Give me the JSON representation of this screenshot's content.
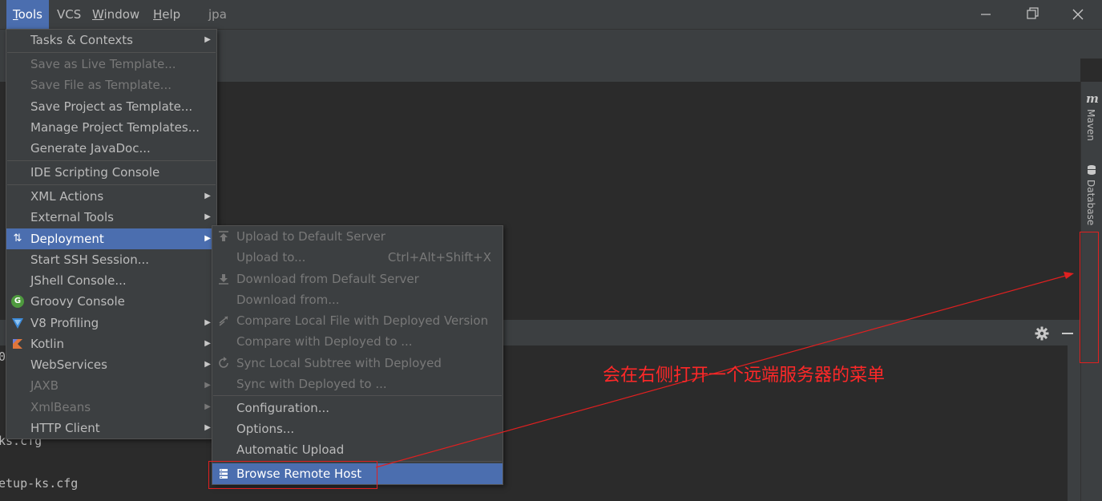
{
  "menubar": {
    "items": [
      {
        "label": "Tools",
        "mnemonic": "T",
        "rest": "ools"
      },
      {
        "label": "VCS"
      },
      {
        "label": "Window",
        "mnemonic": "W",
        "rest": "indow"
      },
      {
        "label": "Help",
        "mnemonic": "H",
        "rest": "elp"
      }
    ],
    "project": "jpa"
  },
  "tools_menu": {
    "items": [
      {
        "label": "Tasks & Contexts",
        "state": "enabled",
        "submenu": true
      },
      {
        "label": "Save as Live Template...",
        "state": "disabled"
      },
      {
        "label": "Save File as Template...",
        "state": "disabled"
      },
      {
        "label": "Save Project as Template...",
        "state": "enabled"
      },
      {
        "label": "Manage Project Templates...",
        "state": "enabled"
      },
      {
        "label": "Generate JavaDoc...",
        "state": "enabled"
      },
      {
        "label": "IDE Scripting Console",
        "state": "enabled"
      },
      {
        "label": "XML Actions",
        "state": "enabled",
        "submenu": true
      },
      {
        "label": "External Tools",
        "state": "enabled",
        "submenu": true
      },
      {
        "label": "Deployment",
        "state": "selected",
        "submenu": true,
        "icon": "deployment-icon"
      },
      {
        "label": "Start SSH Session...",
        "state": "enabled"
      },
      {
        "label": "JShell Console...",
        "state": "enabled"
      },
      {
        "label": "Groovy Console",
        "state": "enabled",
        "icon": "groovy-icon"
      },
      {
        "label": "V8 Profiling",
        "state": "enabled",
        "submenu": true,
        "icon": "v8-icon"
      },
      {
        "label": "Kotlin",
        "state": "enabled",
        "submenu": true,
        "icon": "kotlin-icon"
      },
      {
        "label": "WebServices",
        "state": "enabled",
        "submenu": true
      },
      {
        "label": "JAXB",
        "state": "disabled",
        "submenu": true
      },
      {
        "label": "XmlBeans",
        "state": "disabled",
        "submenu": true
      },
      {
        "label": "HTTP Client",
        "state": "enabled",
        "submenu": true
      }
    ]
  },
  "deployment_menu": {
    "items": [
      {
        "label": "Upload to Default Server",
        "state": "disabled",
        "icon": "upload-icon"
      },
      {
        "label": "Upload to...",
        "state": "disabled",
        "shortcut": "Ctrl+Alt+Shift+X"
      },
      {
        "label": "Download from Default Server",
        "state": "disabled",
        "icon": "download-icon"
      },
      {
        "label": "Download from...",
        "state": "disabled"
      },
      {
        "label": "Compare Local File with Deployed Version",
        "state": "disabled",
        "icon": "compare-icon"
      },
      {
        "label": "Compare with Deployed to ...",
        "state": "disabled"
      },
      {
        "label": "Sync Local Subtree with Deployed",
        "state": "disabled",
        "icon": "sync-icon"
      },
      {
        "label": "Sync with Deployed to ...",
        "state": "disabled"
      },
      {
        "label": "Configuration...",
        "state": "enabled"
      },
      {
        "label": "Options...",
        "state": "enabled"
      },
      {
        "label": "Automatic Upload",
        "state": "enabled"
      },
      {
        "label": "Browse Remote Host",
        "state": "selected",
        "icon": "server-icon"
      }
    ]
  },
  "terminal": {
    "lines": [
      "0",
      "ks.cfg",
      "etup-ks.cfg"
    ]
  },
  "right_strip": {
    "maven_label": "Maven",
    "database_label": "Database"
  },
  "annotation": {
    "text": "会在右侧打开一个远端服务器的菜单"
  },
  "colors": {
    "background": "#2b2b2b",
    "panel": "#3c3f41",
    "selection": "#4b6eaf",
    "annotation": "#e02020"
  }
}
